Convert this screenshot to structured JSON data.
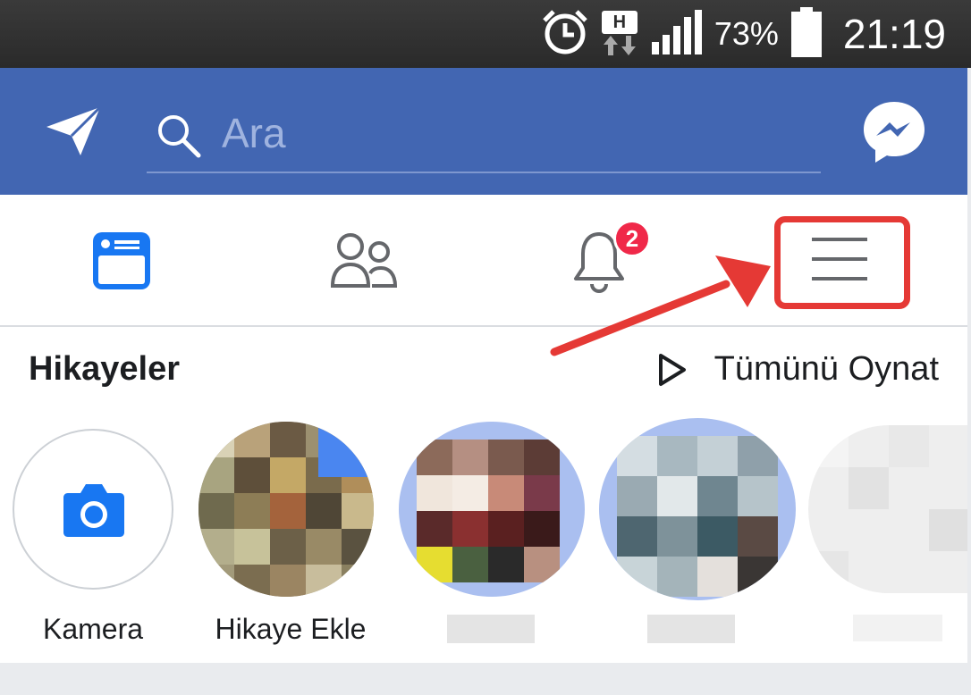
{
  "status_bar": {
    "battery_percent": "73%",
    "time": "21:19",
    "network_label": "H"
  },
  "top_bar": {
    "search_placeholder": "Ara"
  },
  "tabs": {
    "notifications_badge": "2"
  },
  "stories": {
    "title": "Hikayeler",
    "play_all_label": "Tümünü Oynat",
    "items": [
      {
        "label": "Kamera"
      },
      {
        "label": "Hikaye Ekle"
      }
    ]
  },
  "colors": {
    "brand": "#4266b2",
    "accent": "#1877f2",
    "badge": "#f02849",
    "annotation": "#e53935"
  }
}
